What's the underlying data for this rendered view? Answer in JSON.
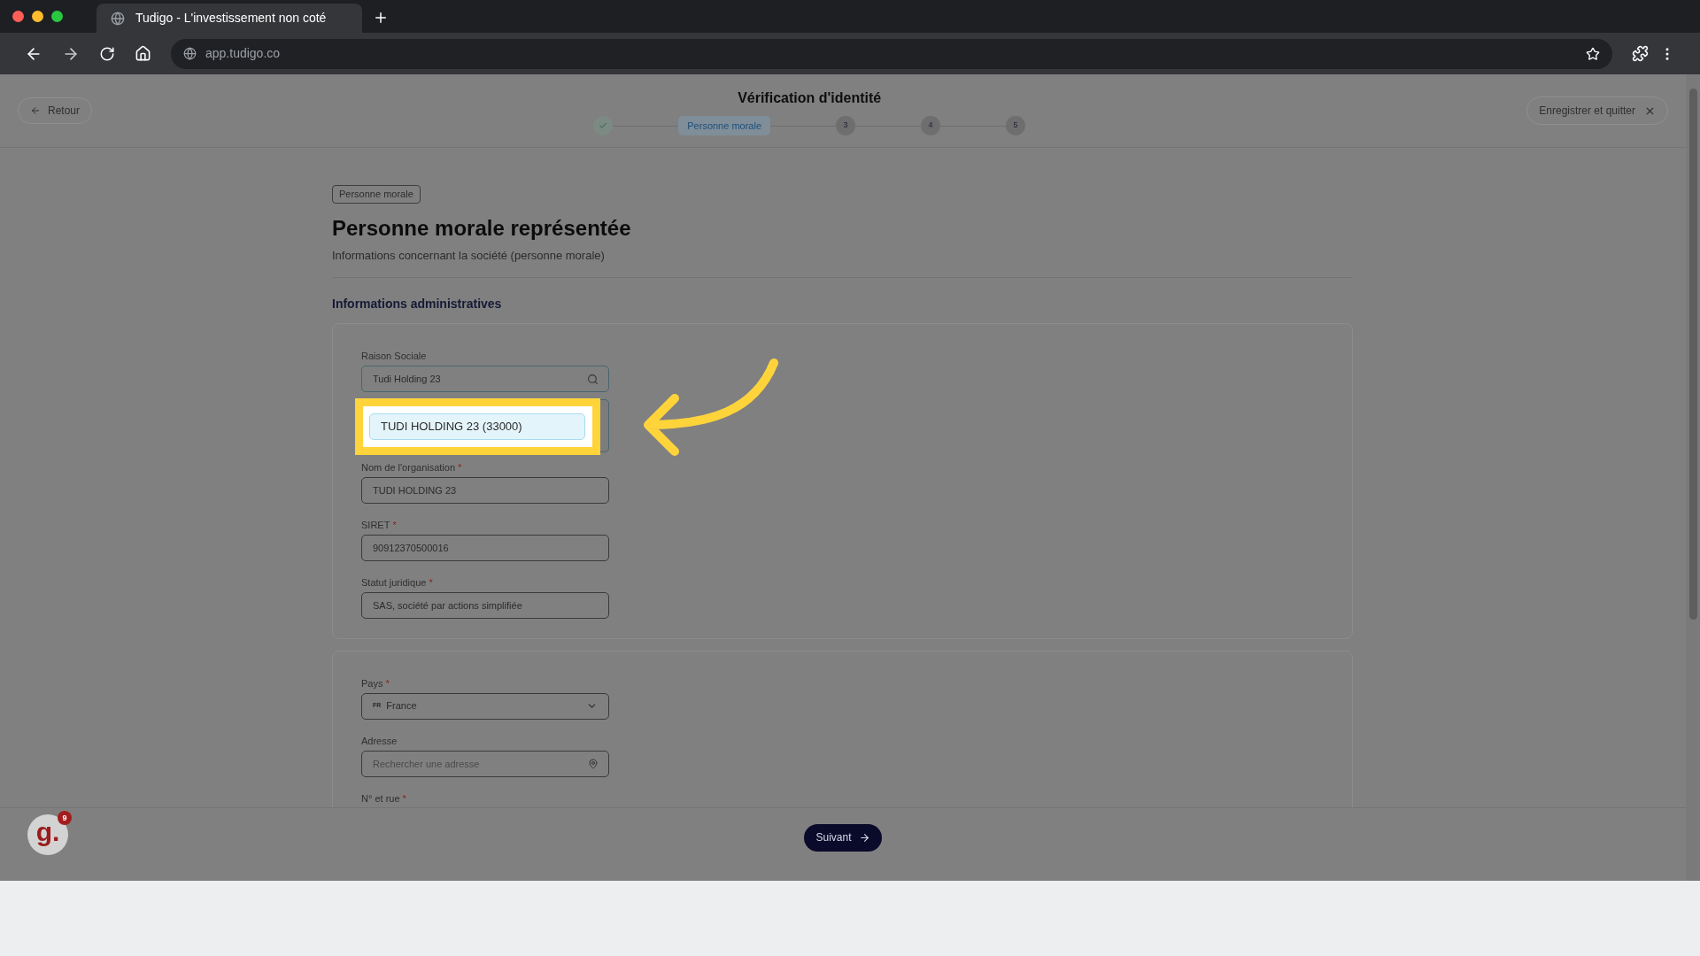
{
  "browser": {
    "tab_title": "Tudigo - L'investissement non coté",
    "url": "app.tudigo.co"
  },
  "header": {
    "back": "Retour",
    "title": "Vérification d'identité",
    "save_quit": "Enregistrer et quitter",
    "steps": [
      {
        "kind": "done"
      },
      {
        "kind": "current",
        "label": "Personne morale"
      },
      {
        "kind": "pending",
        "label": "3"
      },
      {
        "kind": "pending",
        "label": "4"
      },
      {
        "kind": "pending",
        "label": "5"
      }
    ]
  },
  "badge": "Personne morale",
  "heading": "Personne morale représentée",
  "subtitle": "Informations concernant la société (personne morale)",
  "section_title": "Informations administratives",
  "card1": [
    {
      "kind": "search",
      "label": "Raison Sociale",
      "value": "Tudi Holding 23",
      "options": [
        "TUDI HOLDING 23 (33000)"
      ]
    },
    {
      "kind": "text",
      "label": "Nom de l'organisation",
      "required_mark": "*",
      "value": "TUDI HOLDING 23"
    },
    {
      "kind": "text",
      "label": "SIRET",
      "required_mark": "*",
      "value": "90912370500016"
    },
    {
      "kind": "text",
      "label": "Statut juridique",
      "required_mark": "*",
      "value": "SAS, société par actions simplifiée"
    }
  ],
  "card2": [
    {
      "kind": "select",
      "label": "Pays",
      "required_mark": "*",
      "flag": "FR",
      "value": "France"
    },
    {
      "kind": "address",
      "label": "Adresse",
      "placeholder": "Rechercher une adresse"
    },
    {
      "kind": "label",
      "label": "N° et rue",
      "required_mark": "*"
    }
  ],
  "next": "Suivant",
  "launcher": {
    "letter": "g.",
    "badge": "9"
  }
}
